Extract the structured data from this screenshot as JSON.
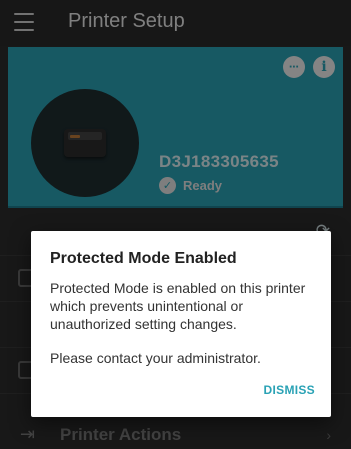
{
  "app_bar": {
    "title": "Printer Setup",
    "menu_icon": "menu-icon"
  },
  "printer": {
    "serial": "D3J183305635",
    "status": "Ready",
    "icons": [
      "link-icon",
      "info-icon",
      "check-icon",
      "refresh-icon",
      "printer-icon"
    ]
  },
  "list": {
    "printer_actions_label": "Printer Actions"
  },
  "dialog": {
    "title": "Protected Mode Enabled",
    "body_1": "Protected Mode is enabled on this printer which prevents unintentional or unauthorized setting changes.",
    "body_2": "Please contact your administrator.",
    "dismiss_label": "DISMISS"
  },
  "colors": {
    "accent": "#2aa2b5",
    "background": "#2c2c2c",
    "dialog": "#ffffff"
  }
}
